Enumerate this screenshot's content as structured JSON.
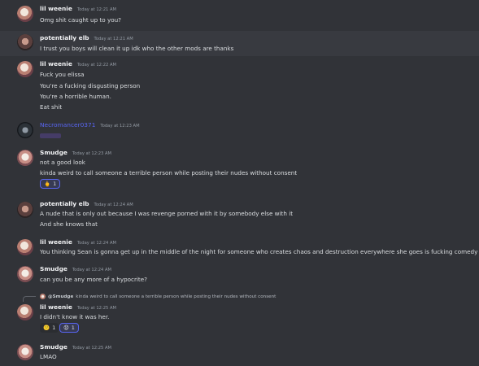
{
  "messages": [
    {
      "user": "lil weenie",
      "time": "Today at 12:21 AM",
      "lines": [
        "Omg shit caught up to you?"
      ]
    },
    {
      "user": "potentially elb",
      "time": "Today at 12:21 AM",
      "lines": [
        "I trust you boys will clean it up idk who the other mods are thanks"
      ]
    },
    {
      "user": "lil weenie",
      "time": "Today at 12:22 AM",
      "lines": [
        "Fuck you elissa",
        "You're a fucking disgusting person",
        "You're a horrible human.",
        "Eat shit"
      ]
    },
    {
      "user": "Necromancer0371",
      "time": "Today at 12:23 AM",
      "lines": []
    },
    {
      "user": "Smudge",
      "time": "Today at 12:23 AM",
      "lines": [
        "not a good look",
        "kinda weird to call someone a terrible person while posting their nudes without consent"
      ],
      "reactions": [
        {
          "emoji": "🖕",
          "count": "1",
          "icon": "middle-finger-emoji-icon",
          "active": true
        }
      ]
    },
    {
      "user": "potentially elb",
      "time": "Today at 12:24 AM",
      "lines": [
        "A nude that is only out because I was revenge porned with it by somebody else with it",
        "And she knows that"
      ]
    },
    {
      "user": "lil weenie",
      "time": "Today at 12:24 AM",
      "lines": [
        "You thinking Sean is gonna get up in the middle of the night for someone who creates chaos and destruction everywhere she goes is fucking comedy"
      ]
    },
    {
      "user": "Smudge",
      "time": "Today at 12:24 AM",
      "lines": [
        "can you be any more of a hypocrite?"
      ]
    },
    {
      "reply": {
        "name": "@Smudge",
        "text": "kinda weird to call someone a terrible person while posting their nudes without consent"
      },
      "user": "lil weenie",
      "time": "Today at 12:25 AM",
      "lines": [
        "I didn't know it was her."
      ],
      "reactions": [
        {
          "emoji": "🙁",
          "count": "1",
          "icon": "frowning-face-emoji-icon",
          "active": false
        },
        {
          "emoji": "😧",
          "count": "1",
          "icon": "anguished-face-emoji-icon",
          "active": true
        }
      ]
    },
    {
      "user": "Smudge",
      "time": "Today at 12:25 AM",
      "lines": [
        "LMAO"
      ]
    }
  ],
  "colors": {
    "background": "#313338",
    "hover": "#383a40",
    "accent": "#5865f2",
    "redacted": "#4b3f73"
  }
}
